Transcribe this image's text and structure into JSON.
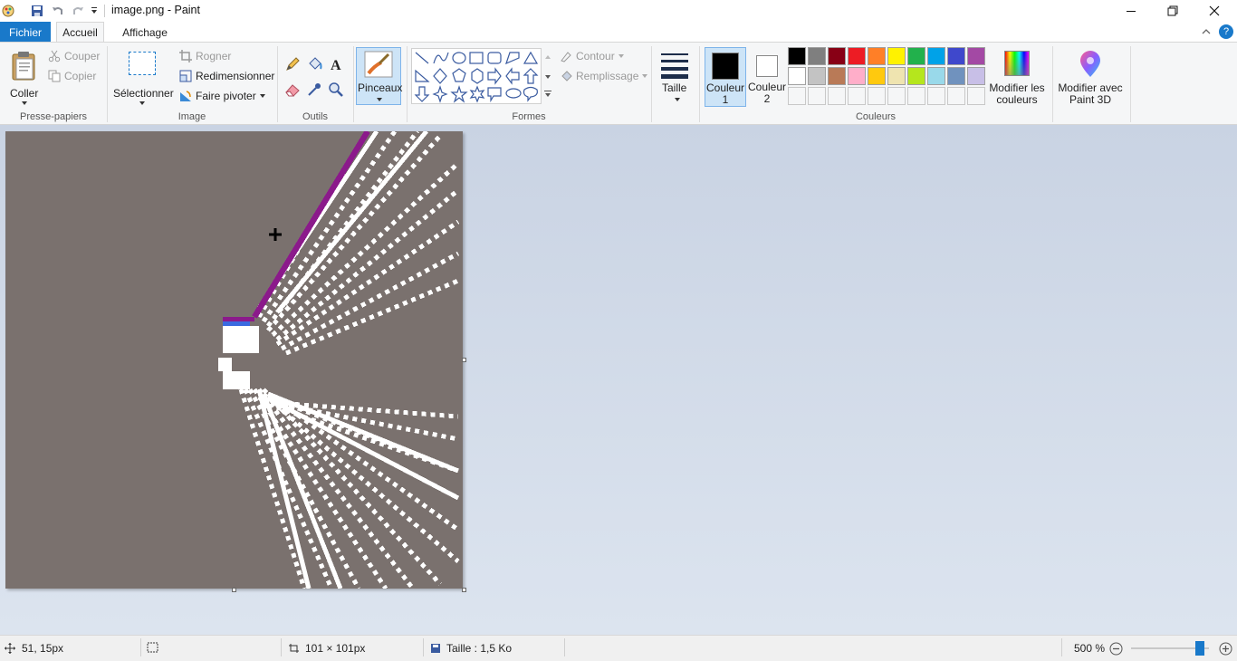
{
  "window": {
    "title": "image.png - Paint"
  },
  "tabs": {
    "file": "Fichier",
    "home": "Accueil",
    "view": "Affichage"
  },
  "clipboard": {
    "paste": "Coller",
    "cut": "Couper",
    "copy": "Copier",
    "group": "Presse-papiers"
  },
  "image": {
    "select": "Sélectionner",
    "crop": "Rogner",
    "resize": "Redimensionner",
    "rotate": "Faire pivoter",
    "group": "Image"
  },
  "tools": {
    "group": "Outils"
  },
  "brushes": {
    "label": "Pinceaux"
  },
  "shapes": {
    "group": "Formes",
    "outline": "Contour",
    "fill": "Remplissage"
  },
  "size": {
    "label": "Taille"
  },
  "colors": {
    "color1_line1": "Couleur",
    "color1_line2": "1",
    "color2_line1": "Couleur",
    "color2_line2": "2",
    "group": "Couleurs",
    "edit_line1": "Modifier les",
    "edit_line2": "couleurs",
    "color1_value": "#000000",
    "color2_value": "#ffffff",
    "palette_row1": [
      "#000000",
      "#7f7f7f",
      "#880015",
      "#ed1c24",
      "#ff7f27",
      "#fff200",
      "#22b14c",
      "#00a2e8",
      "#3f48cc",
      "#a349a4"
    ],
    "palette_row2": [
      "#ffffff",
      "#c3c3c3",
      "#b97a57",
      "#ffaec9",
      "#ffc90e",
      "#efe4b0",
      "#b5e61d",
      "#99d9ea",
      "#7092be",
      "#c8bfe7"
    ]
  },
  "paint3d": {
    "line1": "Modifier avec",
    "line2": "Paint 3D"
  },
  "status": {
    "cursor_pos": "51, 15px",
    "dimensions": "101 × 101px",
    "file_size": "Taille : 1,5 Ko",
    "zoom": "500 %",
    "zoom_level_percent": 500
  },
  "canvas": {
    "background": "#7a716e",
    "stroke": "#ffffff",
    "accent": "#8b1a8b"
  }
}
